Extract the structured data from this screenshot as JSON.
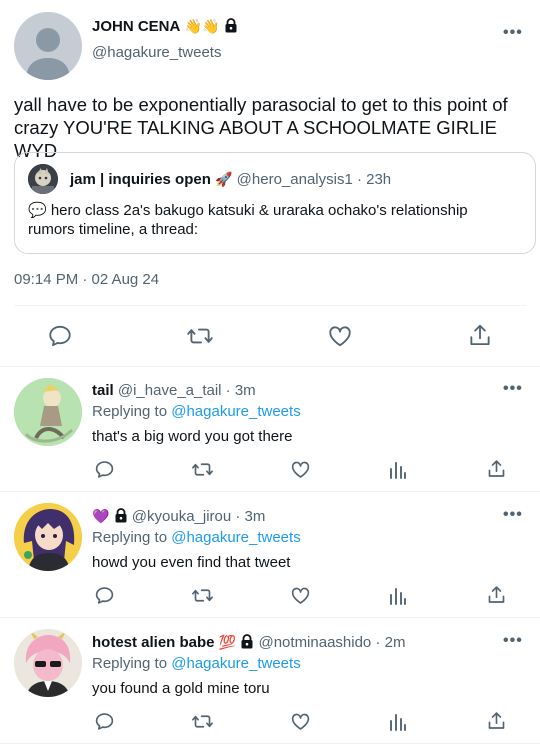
{
  "main_tweet": {
    "display_name": "JOHN CENA",
    "name_emoji": "👋👋",
    "handle": "@hagakure_tweets",
    "text": "yall have to be exponentially parasocial to get to this point of crazy YOU'RE TALKING ABOUT A SCHOOLMATE GIRLIE WYD",
    "quote": {
      "display_name": "jam | inquiries open",
      "name_emoji": "🚀",
      "handle_time": "@hero_analysis1 · 23h",
      "text": "💬 hero class 2a's bakugo katsuki & uraraka ochako's relationship rumors timeline, a thread:"
    },
    "timestamp": "09:14 PM · 02 Aug 24"
  },
  "replies": [
    {
      "display_name": "tail",
      "handle_time": "@i_have_a_tail · 3m",
      "replying_prefix": "Replying to",
      "replying_handle": "@hagakure_tweets",
      "text": "that's a big word you got there"
    },
    {
      "display_name": "💜",
      "handle_time": "@kyouka_jirou · 3m",
      "replying_prefix": "Replying to",
      "replying_handle": "@hagakure_tweets",
      "text": "howd you even find that tweet"
    },
    {
      "display_name": "hotest alien babe",
      "name_emoji": "💯",
      "handle_time": "@notminaashido · 2m",
      "replying_prefix": "Replying to",
      "replying_handle": "@hagakure_tweets",
      "text": "you found a gold mine toru"
    }
  ],
  "more_label": "•••",
  "colors": {
    "accent": "#1d9bf0",
    "muted": "#536471",
    "divider": "#eff3f4",
    "text": "#0f1419"
  },
  "icons": {
    "actions": [
      "reply-icon",
      "retweet-icon",
      "like-icon",
      "views-icon",
      "share-icon"
    ],
    "lock": "lock-icon",
    "more": "more-icon"
  }
}
